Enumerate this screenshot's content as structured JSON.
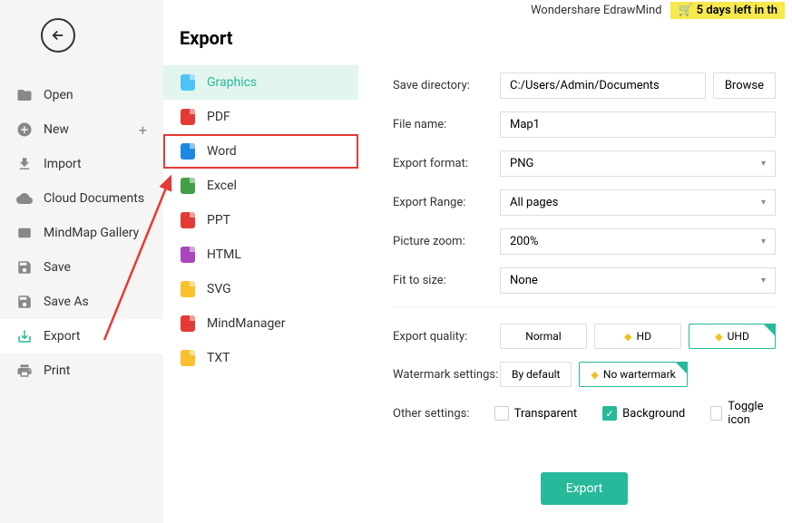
{
  "topbar": {
    "app_title": "Wondershare EdrawMind",
    "days_left": "5 days left in th"
  },
  "left_menu": {
    "items": [
      {
        "label": "Open",
        "icon": "folder"
      },
      {
        "label": "New",
        "icon": "plus-circle",
        "has_plus": true
      },
      {
        "label": "Import",
        "icon": "import"
      },
      {
        "label": "Cloud Documents",
        "icon": "cloud"
      },
      {
        "label": "MindMap Gallery",
        "icon": "gallery"
      },
      {
        "label": "Save",
        "icon": "save"
      },
      {
        "label": "Save As",
        "icon": "save-as"
      },
      {
        "label": "Export",
        "icon": "export",
        "active": true
      },
      {
        "label": "Print",
        "icon": "print"
      }
    ]
  },
  "sub_panel": {
    "title": "Export",
    "items": [
      {
        "label": "Graphics",
        "color": "#4fc3f7",
        "selected": true
      },
      {
        "label": "PDF",
        "color": "#e53935"
      },
      {
        "label": "Word",
        "color": "#1e88e5",
        "highlighted": true
      },
      {
        "label": "Excel",
        "color": "#43a047"
      },
      {
        "label": "PPT",
        "color": "#e53935"
      },
      {
        "label": "HTML",
        "color": "#ab47bc"
      },
      {
        "label": "SVG",
        "color": "#fbc02d"
      },
      {
        "label": "MindManager",
        "color": "#e53935"
      },
      {
        "label": "TXT",
        "color": "#fbc02d"
      }
    ]
  },
  "form": {
    "save_directory": {
      "label": "Save directory:",
      "value": "C:/Users/Admin/Documents",
      "browse": "Browse"
    },
    "file_name": {
      "label": "File name:",
      "value": "Map1"
    },
    "export_format": {
      "label": "Export format:",
      "value": "PNG"
    },
    "export_range": {
      "label": "Export Range:",
      "value": "All pages"
    },
    "picture_zoom": {
      "label": "Picture zoom:",
      "value": "200%"
    },
    "fit_to_size": {
      "label": "Fit to size:",
      "value": "None"
    },
    "export_quality": {
      "label": "Export quality:",
      "options": [
        "Normal",
        "HD",
        "UHD"
      ]
    },
    "watermark": {
      "label": "Watermark settings:",
      "options": [
        "By default",
        "No wartermark"
      ]
    },
    "other_settings": {
      "label": "Other settings:",
      "transparent": "Transparent",
      "background": "Background",
      "toggle_icon": "Toggle icon"
    },
    "export_button": "Export"
  }
}
